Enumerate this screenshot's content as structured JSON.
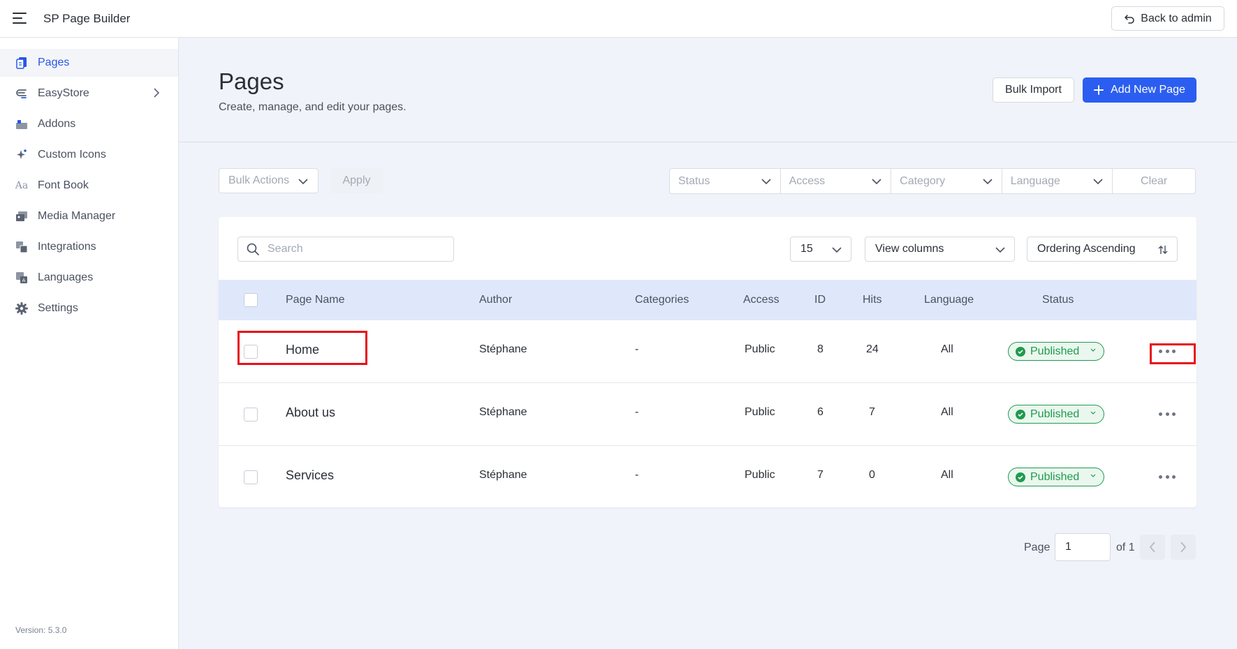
{
  "app": {
    "title": "SP Page Builder",
    "back_button": "Back to admin"
  },
  "sidebar": {
    "items": [
      {
        "label": "Pages",
        "icon": "pages-icon",
        "active": true
      },
      {
        "label": "EasyStore",
        "icon": "easystore-icon",
        "has_submenu": true
      },
      {
        "label": "Addons",
        "icon": "addons-icon"
      },
      {
        "label": "Custom Icons",
        "icon": "sparkle-icon"
      },
      {
        "label": "Font Book",
        "icon": "font-icon"
      },
      {
        "label": "Media Manager",
        "icon": "media-icon"
      },
      {
        "label": "Integrations",
        "icon": "integrations-icon"
      },
      {
        "label": "Languages",
        "icon": "languages-icon"
      },
      {
        "label": "Settings",
        "icon": "gear-icon"
      }
    ],
    "version": "Version: 5.3.0"
  },
  "header": {
    "title": "Pages",
    "subtitle": "Create, manage, and edit your pages.",
    "bulk_import": "Bulk Import",
    "add_new": "Add New Page"
  },
  "filters": {
    "bulk_actions": "Bulk Actions",
    "apply": "Apply",
    "status": "Status",
    "access": "Access",
    "category": "Category",
    "language": "Language",
    "clear": "Clear"
  },
  "table": {
    "search_placeholder": "Search",
    "per_page": "15",
    "view_columns": "View columns",
    "ordering": "Ordering Ascending",
    "columns": [
      "Page Name",
      "Author",
      "Categories",
      "Access",
      "ID",
      "Hits",
      "Language",
      "Status"
    ],
    "rows": [
      {
        "name": "Home",
        "author": "Stéphane",
        "categories": "-",
        "access": "Public",
        "id": "8",
        "hits": "24",
        "language": "All",
        "status": "Published"
      },
      {
        "name": "About us",
        "author": "Stéphane",
        "categories": "-",
        "access": "Public",
        "id": "6",
        "hits": "7",
        "language": "All",
        "status": "Published"
      },
      {
        "name": "Services",
        "author": "Stéphane",
        "categories": "-",
        "access": "Public",
        "id": "7",
        "hits": "0",
        "language": "All",
        "status": "Published"
      }
    ]
  },
  "pagination": {
    "label": "Page",
    "current": "1",
    "of": "of 1"
  },
  "colors": {
    "accent": "#2b5ef0",
    "published": "#1f9b4c",
    "highlight": "#e8101a"
  }
}
